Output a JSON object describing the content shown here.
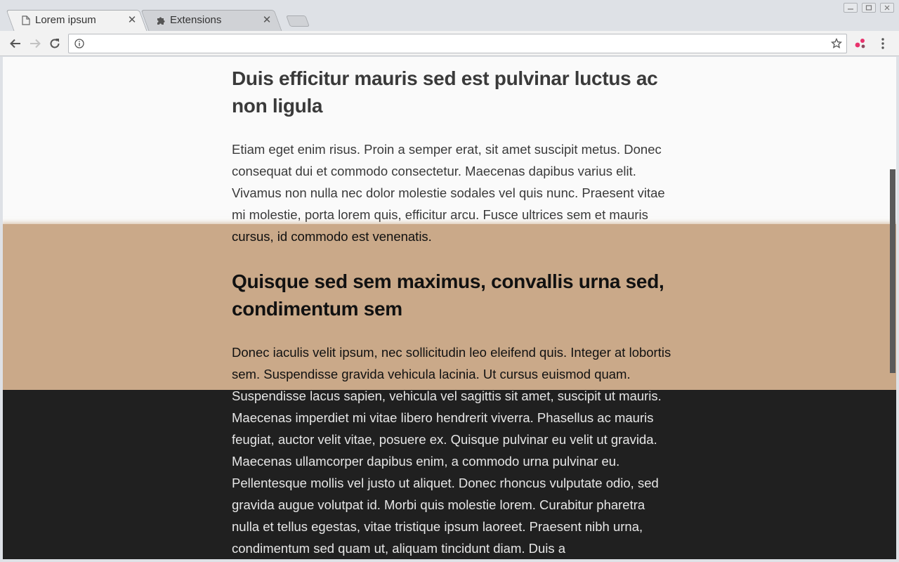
{
  "tabs": [
    {
      "title": "Lorem ipsum",
      "close": "✕",
      "active": true,
      "icon": "page-icon"
    },
    {
      "title": "Extensions",
      "close": "✕",
      "active": false,
      "icon": "puzzle-icon"
    }
  ],
  "omnibox": {
    "value": "",
    "placeholder": ""
  },
  "article": {
    "heading_a": "Duis efficitur mauris sed est pulvinar luctus ac non ligula",
    "para_a": "Etiam eget enim risus. Proin a semper erat, sit amet suscipit metus. Donec consequat dui et commodo consectetur. Maecenas dapibus varius elit. Vivamus non nulla nec dolor molestie sodales vel quis nunc. Praesent vitae mi molestie, porta lorem quis, efficitur arcu. Fusce ultrices sem et mauris cursus, id commodo est venenatis.",
    "heading_b": "Quisque sed sem maximus, convallis urna sed, condimentum sem",
    "para_b": "Donec iaculis velit ipsum, nec sollicitudin leo eleifend quis. Integer at lobortis sem. Suspendisse gravida vehicula lacinia. Ut cursus euismod quam. Suspendisse lacus sapien, vehicula vel sagittis sit amet, suscipit ut mauris. Maecenas imperdiet mi vitae libero hendrerit viverra. Phasellus ac mauris feugiat, auctor velit vitae, posuere ex. Quisque pulvinar eu velit ut gravida. Maecenas ullamcorper dapibus enim, a commodo urna pulvinar eu. Pellentesque mollis vel justo ut aliquet. Donec rhoncus vulputate odio, sed gravida augue volutpat id. Morbi quis molestie lorem. Curabitur pharetra nulla et tellus egestas, vitae tristique ipsum laoreet. Praesent nibh urna, condimentum sed quam ut, aliquam tincidunt diam. Duis a"
  },
  "colors": {
    "band_tan": "#c4a07c",
    "band_dark": "#202020",
    "extension_accent": "#e8336d"
  }
}
